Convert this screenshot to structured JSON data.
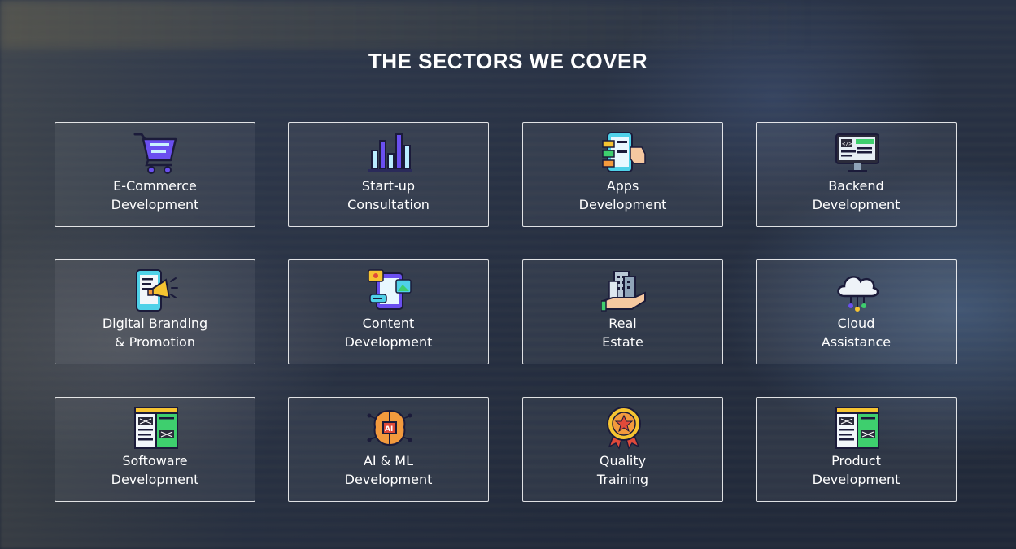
{
  "section": {
    "title": "THE SECTORS WE COVER"
  },
  "sectors": [
    {
      "line1": "E-Commerce",
      "line2": "Development",
      "icon": "shopping-cart-icon"
    },
    {
      "line1": "Start-up",
      "line2": "Consultation",
      "icon": "bar-chart-icon"
    },
    {
      "line1": "Apps",
      "line2": "Development",
      "icon": "mobile-app-icon"
    },
    {
      "line1": "Backend",
      "line2": "Development",
      "icon": "code-monitor-icon"
    },
    {
      "line1": "Digital Branding",
      "line2": "& Promotion",
      "icon": "megaphone-phone-icon"
    },
    {
      "line1": "Content",
      "line2": "Development",
      "icon": "content-media-icon"
    },
    {
      "line1": "Real",
      "line2": "Estate",
      "icon": "building-hand-icon"
    },
    {
      "line1": "Cloud",
      "line2": "Assistance",
      "icon": "cloud-icon"
    },
    {
      "line1": "Softoware",
      "line2": "Development",
      "icon": "software-window-icon"
    },
    {
      "line1": "AI & ML",
      "line2": "Development",
      "icon": "ai-chip-icon"
    },
    {
      "line1": "Quality",
      "line2": "Training",
      "icon": "medal-icon"
    },
    {
      "line1": "Product",
      "line2": "Development",
      "icon": "product-window-icon"
    }
  ],
  "colors": {
    "border": "#ffffff",
    "text": "#ffffff",
    "accent_green": "#3ecf6e",
    "accent_purple": "#5b3fd0",
    "accent_yellow": "#f6c431"
  }
}
